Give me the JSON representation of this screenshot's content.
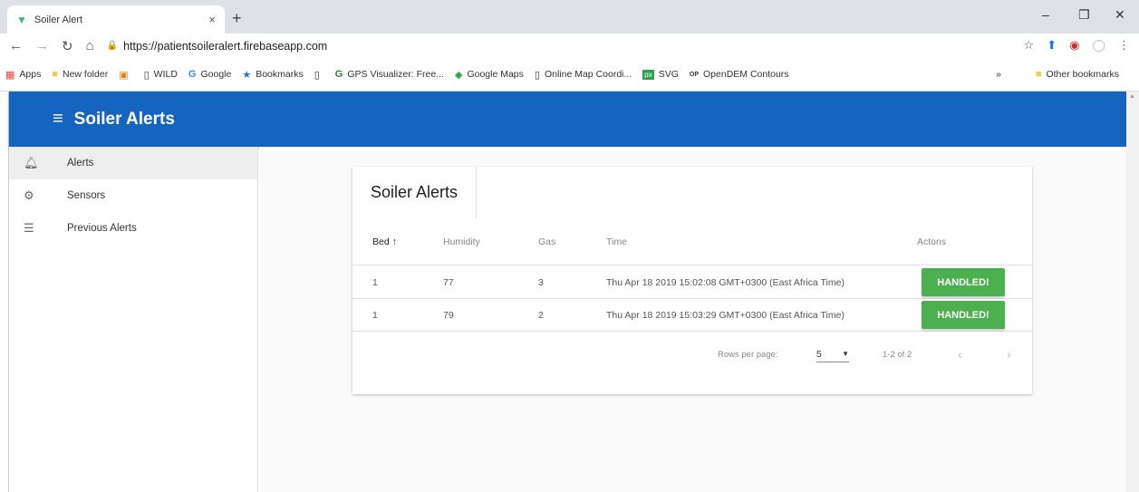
{
  "browser": {
    "tab_title": "Soiler Alert",
    "tab_close": "×",
    "new_tab": "+",
    "url": "https://patientsoileralert.firebaseapp.com",
    "bookmarks": [
      {
        "icon": "apps-grid-icon",
        "label": "Apps"
      },
      {
        "icon": "folder-icon",
        "label": "New folder"
      },
      {
        "icon": "bookmark-orange-icon",
        "label": ""
      },
      {
        "icon": "page-icon",
        "label": "WILD"
      },
      {
        "icon": "google-icon",
        "label": "Google"
      },
      {
        "icon": "star-icon",
        "label": "Bookmarks"
      },
      {
        "icon": "page-icon",
        "label": ""
      },
      {
        "icon": "gps-icon",
        "label": "GPS Visualizer: Free..."
      },
      {
        "icon": "maps-icon",
        "label": "Google Maps"
      },
      {
        "icon": "page-icon",
        "label": "Online Map Coordi..."
      },
      {
        "icon": "px-icon",
        "label": "SVG"
      },
      {
        "icon": "opendem-icon",
        "label": "OpenDEM Contours"
      }
    ],
    "bookmarks_overflow": "»",
    "other_bookmarks": "Other bookmarks"
  },
  "app": {
    "title": "Soiler Alerts",
    "brand_color": "#1565c0"
  },
  "sidebar": {
    "items": [
      {
        "label": "Alerts",
        "icon": "bell-icon"
      },
      {
        "label": "Sensors",
        "icon": "gear-icon"
      },
      {
        "label": "Previous Alerts",
        "icon": "list-icon"
      }
    ]
  },
  "card": {
    "title": "Soiler Alerts",
    "columns": {
      "bed": "Bed",
      "sort_arrow": "↑",
      "humidity": "Humidity",
      "gas": "Gas",
      "time": "Time",
      "actions": "Actons"
    },
    "rows": [
      {
        "bed": "1",
        "humidity": "77",
        "gas": "3",
        "time": "Thu Apr 18 2019 15:02:08 GMT+0300 (East Africa Time)",
        "action": "HANDLED!"
      },
      {
        "bed": "1",
        "humidity": "79",
        "gas": "2",
        "time": "Thu Apr 18 2019 15:03:29 GMT+0300 (East Africa Time)",
        "action": "HANDLED!"
      }
    ],
    "footer": {
      "rows_per_page_label": "Rows per page:",
      "rows_per_page_value": "5",
      "range": "1-2 of 2",
      "prev": "‹",
      "next": "›"
    },
    "action_color": "#4caf50"
  }
}
